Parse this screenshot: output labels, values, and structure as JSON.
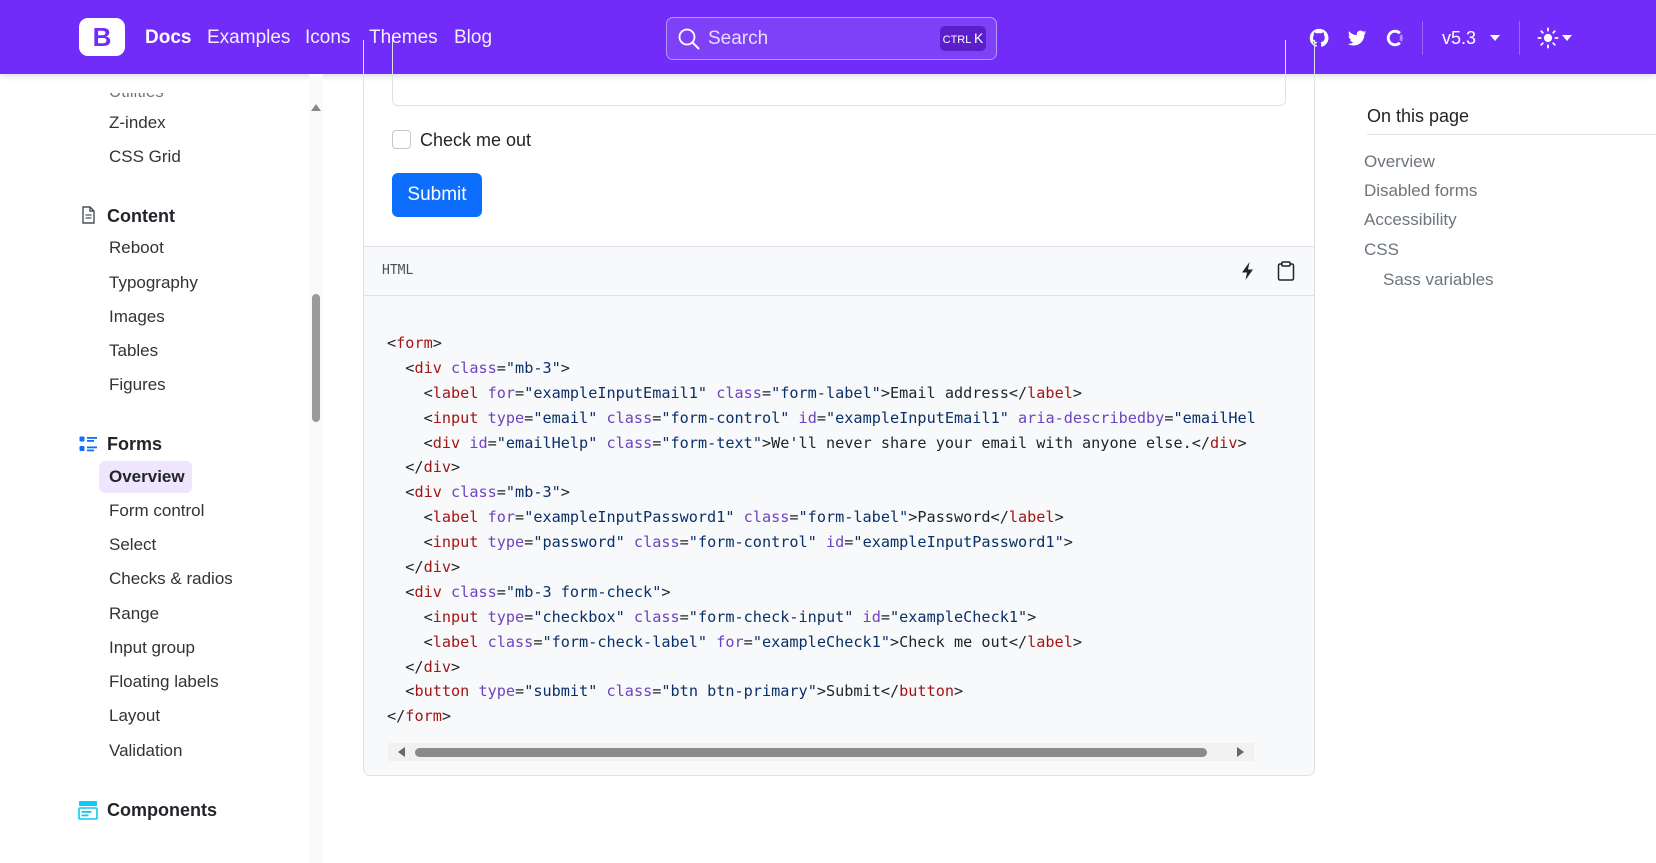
{
  "navbar": {
    "brand_letter": "B",
    "links": [
      "Docs",
      "Examples",
      "Icons",
      "Themes",
      "Blog"
    ],
    "search_placeholder": "Search",
    "search_shortcut_ctrl": "CTRL",
    "search_shortcut_key": "K",
    "version": "v5.3",
    "accent_color": "#712cf9"
  },
  "sidebar": {
    "clipped_top_item": "Utilities",
    "utilities_items": [
      "Z-index",
      "CSS Grid"
    ],
    "content_heading": "Content",
    "content_items": [
      "Reboot",
      "Typography",
      "Images",
      "Tables",
      "Figures"
    ],
    "forms_heading": "Forms",
    "forms_active_item": "Overview",
    "forms_items": [
      "Form control",
      "Select",
      "Checks & radios",
      "Range",
      "Input group",
      "Floating labels",
      "Layout",
      "Validation"
    ],
    "components_heading": "Components"
  },
  "example": {
    "checkbox_label": "Check me out",
    "submit_label": "Submit",
    "submit_color": "#0d6efd"
  },
  "code": {
    "language": "HTML",
    "line_01": [
      [
        "p",
        "<"
      ],
      [
        "t",
        "form"
      ],
      [
        "p",
        ">"
      ]
    ],
    "line_02": [
      [
        "p",
        "  <"
      ],
      [
        "t",
        "div"
      ],
      [
        "p",
        " "
      ],
      [
        "a",
        "class"
      ],
      [
        "p",
        "="
      ],
      [
        "v",
        "\"mb-3\""
      ],
      [
        "p",
        ">"
      ]
    ],
    "line_03": [
      [
        "p",
        "    <"
      ],
      [
        "t",
        "label"
      ],
      [
        "p",
        " "
      ],
      [
        "a",
        "for"
      ],
      [
        "p",
        "="
      ],
      [
        "v",
        "\"exampleInputEmail1\""
      ],
      [
        "p",
        " "
      ],
      [
        "a",
        "class"
      ],
      [
        "p",
        "="
      ],
      [
        "v",
        "\"form-label\""
      ],
      [
        "p",
        ">Email address</"
      ],
      [
        "t",
        "label"
      ],
      [
        "p",
        ">"
      ]
    ],
    "line_04": [
      [
        "p",
        "    <"
      ],
      [
        "t",
        "input"
      ],
      [
        "p",
        " "
      ],
      [
        "a",
        "type"
      ],
      [
        "p",
        "="
      ],
      [
        "v",
        "\"email\""
      ],
      [
        "p",
        " "
      ],
      [
        "a",
        "class"
      ],
      [
        "p",
        "="
      ],
      [
        "v",
        "\"form-control\""
      ],
      [
        "p",
        " "
      ],
      [
        "a",
        "id"
      ],
      [
        "p",
        "="
      ],
      [
        "v",
        "\"exampleInputEmail1\""
      ],
      [
        "p",
        " "
      ],
      [
        "a",
        "aria-describedby"
      ],
      [
        "p",
        "="
      ],
      [
        "v",
        "\"emailHelp\""
      ],
      [
        "p",
        ">"
      ]
    ],
    "line_05": [
      [
        "p",
        "    <"
      ],
      [
        "t",
        "div"
      ],
      [
        "p",
        " "
      ],
      [
        "a",
        "id"
      ],
      [
        "p",
        "="
      ],
      [
        "v",
        "\"emailHelp\""
      ],
      [
        "p",
        " "
      ],
      [
        "a",
        "class"
      ],
      [
        "p",
        "="
      ],
      [
        "v",
        "\"form-text\""
      ],
      [
        "p",
        ">We'll never share your email with anyone else.</"
      ],
      [
        "t",
        "div"
      ],
      [
        "p",
        ">"
      ]
    ],
    "line_06": [
      [
        "p",
        "  </"
      ],
      [
        "t",
        "div"
      ],
      [
        "p",
        ">"
      ]
    ],
    "line_07": [
      [
        "p",
        "  <"
      ],
      [
        "t",
        "div"
      ],
      [
        "p",
        " "
      ],
      [
        "a",
        "class"
      ],
      [
        "p",
        "="
      ],
      [
        "v",
        "\"mb-3\""
      ],
      [
        "p",
        ">"
      ]
    ],
    "line_08": [
      [
        "p",
        "    <"
      ],
      [
        "t",
        "label"
      ],
      [
        "p",
        " "
      ],
      [
        "a",
        "for"
      ],
      [
        "p",
        "="
      ],
      [
        "v",
        "\"exampleInputPassword1\""
      ],
      [
        "p",
        " "
      ],
      [
        "a",
        "class"
      ],
      [
        "p",
        "="
      ],
      [
        "v",
        "\"form-label\""
      ],
      [
        "p",
        ">Password</"
      ],
      [
        "t",
        "label"
      ],
      [
        "p",
        ">"
      ]
    ],
    "line_09": [
      [
        "p",
        "    <"
      ],
      [
        "t",
        "input"
      ],
      [
        "p",
        " "
      ],
      [
        "a",
        "type"
      ],
      [
        "p",
        "="
      ],
      [
        "v",
        "\"password\""
      ],
      [
        "p",
        " "
      ],
      [
        "a",
        "class"
      ],
      [
        "p",
        "="
      ],
      [
        "v",
        "\"form-control\""
      ],
      [
        "p",
        " "
      ],
      [
        "a",
        "id"
      ],
      [
        "p",
        "="
      ],
      [
        "v",
        "\"exampleInputPassword1\""
      ],
      [
        "p",
        ">"
      ]
    ],
    "line_10": [
      [
        "p",
        "  </"
      ],
      [
        "t",
        "div"
      ],
      [
        "p",
        ">"
      ]
    ],
    "line_11": [
      [
        "p",
        "  <"
      ],
      [
        "t",
        "div"
      ],
      [
        "p",
        " "
      ],
      [
        "a",
        "class"
      ],
      [
        "p",
        "="
      ],
      [
        "v",
        "\"mb-3 form-check\""
      ],
      [
        "p",
        ">"
      ]
    ],
    "line_12": [
      [
        "p",
        "    <"
      ],
      [
        "t",
        "input"
      ],
      [
        "p",
        " "
      ],
      [
        "a",
        "type"
      ],
      [
        "p",
        "="
      ],
      [
        "v",
        "\"checkbox\""
      ],
      [
        "p",
        " "
      ],
      [
        "a",
        "class"
      ],
      [
        "p",
        "="
      ],
      [
        "v",
        "\"form-check-input\""
      ],
      [
        "p",
        " "
      ],
      [
        "a",
        "id"
      ],
      [
        "p",
        "="
      ],
      [
        "v",
        "\"exampleCheck1\""
      ],
      [
        "p",
        ">"
      ]
    ],
    "line_13": [
      [
        "p",
        "    <"
      ],
      [
        "t",
        "label"
      ],
      [
        "p",
        " "
      ],
      [
        "a",
        "class"
      ],
      [
        "p",
        "="
      ],
      [
        "v",
        "\"form-check-label\""
      ],
      [
        "p",
        " "
      ],
      [
        "a",
        "for"
      ],
      [
        "p",
        "="
      ],
      [
        "v",
        "\"exampleCheck1\""
      ],
      [
        "p",
        ">Check me out</"
      ],
      [
        "t",
        "label"
      ],
      [
        "p",
        ">"
      ]
    ],
    "line_14": [
      [
        "p",
        "  </"
      ],
      [
        "t",
        "div"
      ],
      [
        "p",
        ">"
      ]
    ],
    "line_15": [
      [
        "p",
        "  <"
      ],
      [
        "t",
        "button"
      ],
      [
        "p",
        " "
      ],
      [
        "a",
        "type"
      ],
      [
        "p",
        "="
      ],
      [
        "v",
        "\"submit\""
      ],
      [
        "p",
        " "
      ],
      [
        "a",
        "class"
      ],
      [
        "p",
        "="
      ],
      [
        "v",
        "\"btn btn-primary\""
      ],
      [
        "p",
        ">Submit</"
      ],
      [
        "t",
        "button"
      ],
      [
        "p",
        ">"
      ]
    ],
    "line_16": [
      [
        "p",
        "</"
      ],
      [
        "t",
        "form"
      ],
      [
        "p",
        ">"
      ]
    ]
  },
  "toc": {
    "title": "On this page",
    "items": [
      "Overview",
      "Disabled forms",
      "Accessibility",
      "CSS"
    ],
    "sub_items": [
      "Sass variables"
    ]
  }
}
